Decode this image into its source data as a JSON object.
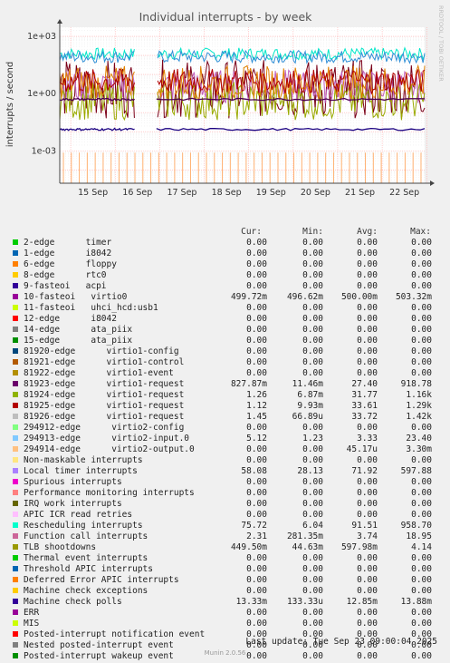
{
  "chart_data": {
    "type": "line",
    "title": "Individual interrupts - by week",
    "ylabel": "interrupts / second",
    "y_scale": "log",
    "ylim": [
      2e-05,
      3000
    ],
    "y_ticks": [
      "1e+03",
      "1e+00",
      "1e-03"
    ],
    "x_ticks": [
      "15 Sep",
      "16 Sep",
      "17 Sep",
      "18 Sep",
      "19 Sep",
      "20 Sep",
      "21 Sep",
      "22 Sep"
    ],
    "watermark": "RRDTOOL / TOBI OETIKER",
    "grid": true,
    "bands": [
      {
        "name": "Rescheduling interrupts",
        "color": "#00e6c8",
        "lo": 60,
        "hi": 250
      },
      {
        "name": "Local timer interrupts",
        "color": "#2f8ed6",
        "lo": 40,
        "hi": 180
      },
      {
        "name": "virtio1-request",
        "color": "#7a0018",
        "lo": 0.05,
        "hi": 60
      },
      {
        "name": "Function call interrupts",
        "color": "#c060c0",
        "lo": 0.3,
        "hi": 18
      },
      {
        "name": "TLB shootdowns",
        "color": "#99aa00",
        "lo": 0.04,
        "hi": 4
      },
      {
        "name": "virtio1-request",
        "color": "#e08000",
        "lo": 0.5,
        "hi": 30
      },
      {
        "name": "virtio1-request",
        "color": "#b00000",
        "lo": 1,
        "hi": 20
      }
    ],
    "flat_series": [
      {
        "name": "Machine check polls",
        "color": "#1a0080",
        "value": 0.0133
      },
      {
        "name": "virtio1-request",
        "color": "#4a0050",
        "value": 0.5
      }
    ],
    "spike_series": {
      "name": "294914-edge virtio2-output.0",
      "color": "#ffb070",
      "value": 3.3,
      "floor": 2e-05
    }
  },
  "legend": {
    "headers": {
      "cur": "Cur:",
      "min": "Min:",
      "avg": "Avg:",
      "max": "Max:"
    },
    "rows": [
      {
        "color": "#00cc00",
        "name": "2-edge      timer",
        "cur": "0.00",
        "min": "0.00",
        "avg": "0.00",
        "max": "0.00"
      },
      {
        "color": "#0066b3",
        "name": "1-edge      i8042",
        "cur": "0.00",
        "min": "0.00",
        "avg": "0.00",
        "max": "0.00"
      },
      {
        "color": "#ff8000",
        "name": "6-edge      floppy",
        "cur": "0.00",
        "min": "0.00",
        "avg": "0.00",
        "max": "0.00"
      },
      {
        "color": "#ffcc00",
        "name": "8-edge      rtc0",
        "cur": "0.00",
        "min": "0.00",
        "avg": "0.00",
        "max": "0.00"
      },
      {
        "color": "#330099",
        "name": "9-fasteoi   acpi",
        "cur": "0.00",
        "min": "0.00",
        "avg": "0.00",
        "max": "0.00"
      },
      {
        "color": "#990099",
        "name": "10-fasteoi   virtio0",
        "cur": "499.72m",
        "min": "496.62m",
        "avg": "500.00m",
        "max": "503.32m"
      },
      {
        "color": "#ccff00",
        "name": "11-fasteoi   uhci_hcd:usb1",
        "cur": "0.00",
        "min": "0.00",
        "avg": "0.00",
        "max": "0.00"
      },
      {
        "color": "#ff0000",
        "name": "12-edge      i8042",
        "cur": "0.00",
        "min": "0.00",
        "avg": "0.00",
        "max": "0.00"
      },
      {
        "color": "#808080",
        "name": "14-edge      ata_piix",
        "cur": "0.00",
        "min": "0.00",
        "avg": "0.00",
        "max": "0.00"
      },
      {
        "color": "#008f00",
        "name": "15-edge      ata_piix",
        "cur": "0.00",
        "min": "0.00",
        "avg": "0.00",
        "max": "0.00"
      },
      {
        "color": "#00487d",
        "name": "81920-edge      virtio1-config",
        "cur": "0.00",
        "min": "0.00",
        "avg": "0.00",
        "max": "0.00"
      },
      {
        "color": "#b35a00",
        "name": "81921-edge      virtio1-control",
        "cur": "0.00",
        "min": "0.00",
        "avg": "0.00",
        "max": "0.00"
      },
      {
        "color": "#b38f00",
        "name": "81922-edge      virtio1-event",
        "cur": "0.00",
        "min": "0.00",
        "avg": "0.00",
        "max": "0.00"
      },
      {
        "color": "#6b006b",
        "name": "81923-edge      virtio1-request",
        "cur": "827.87m",
        "min": "11.46m",
        "avg": "27.40",
        "max": "918.78"
      },
      {
        "color": "#8fb300",
        "name": "81924-edge      virtio1-request",
        "cur": "1.26",
        "min": "6.87m",
        "avg": "31.77",
        "max": "1.16k"
      },
      {
        "color": "#b30000",
        "name": "81925-edge      virtio1-request",
        "cur": "1.12",
        "min": "9.93m",
        "avg": "33.61",
        "max": "1.29k"
      },
      {
        "color": "#bebebe",
        "name": "81926-edge      virtio1-request",
        "cur": "1.45",
        "min": "66.89u",
        "avg": "33.72",
        "max": "1.42k"
      },
      {
        "color": "#80ff80",
        "name": "294912-edge      virtio2-config",
        "cur": "0.00",
        "min": "0.00",
        "avg": "0.00",
        "max": "0.00"
      },
      {
        "color": "#80c9ff",
        "name": "294913-edge      virtio2-input.0",
        "cur": "5.12",
        "min": "1.23",
        "avg": "3.33",
        "max": "23.40"
      },
      {
        "color": "#ffc080",
        "name": "294914-edge      virtio2-output.0",
        "cur": "0.00",
        "min": "0.00",
        "avg": "45.17u",
        "max": "3.30m"
      },
      {
        "color": "#ffe680",
        "name": "Non-maskable interrupts",
        "cur": "0.00",
        "min": "0.00",
        "avg": "0.00",
        "max": "0.00"
      },
      {
        "color": "#aa80ff",
        "name": "Local timer interrupts",
        "cur": "58.08",
        "min": "28.13",
        "avg": "71.92",
        "max": "597.88"
      },
      {
        "color": "#ee00cc",
        "name": "Spurious interrupts",
        "cur": "0.00",
        "min": "0.00",
        "avg": "0.00",
        "max": "0.00"
      },
      {
        "color": "#ff8080",
        "name": "Performance monitoring interrupts",
        "cur": "0.00",
        "min": "0.00",
        "avg": "0.00",
        "max": "0.00"
      },
      {
        "color": "#666600",
        "name": "IRQ work interrupts",
        "cur": "0.00",
        "min": "0.00",
        "avg": "0.00",
        "max": "0.00"
      },
      {
        "color": "#ffbfff",
        "name": "APIC ICR read retries",
        "cur": "0.00",
        "min": "0.00",
        "avg": "0.00",
        "max": "0.00"
      },
      {
        "color": "#00ffcc",
        "name": "Rescheduling interrupts",
        "cur": "75.72",
        "min": "6.04",
        "avg": "91.51",
        "max": "958.70"
      },
      {
        "color": "#cc6699",
        "name": "Function call interrupts",
        "cur": "2.31",
        "min": "281.35m",
        "avg": "3.74",
        "max": "18.95"
      },
      {
        "color": "#999900",
        "name": "TLB shootdowns",
        "cur": "449.50m",
        "min": "44.63m",
        "avg": "597.98m",
        "max": "4.14"
      },
      {
        "color": "#00cc00",
        "name": "Thermal event interrupts",
        "cur": "0.00",
        "min": "0.00",
        "avg": "0.00",
        "max": "0.00"
      },
      {
        "color": "#0066b3",
        "name": "Threshold APIC interrupts",
        "cur": "0.00",
        "min": "0.00",
        "avg": "0.00",
        "max": "0.00"
      },
      {
        "color": "#ff8000",
        "name": "Deferred Error APIC interrupts",
        "cur": "0.00",
        "min": "0.00",
        "avg": "0.00",
        "max": "0.00"
      },
      {
        "color": "#ffcc00",
        "name": "Machine check exceptions",
        "cur": "0.00",
        "min": "0.00",
        "avg": "0.00",
        "max": "0.00"
      },
      {
        "color": "#330099",
        "name": "Machine check polls",
        "cur": "13.33m",
        "min": "133.33u",
        "avg": "12.85m",
        "max": "13.88m"
      },
      {
        "color": "#990099",
        "name": "ERR",
        "cur": "0.00",
        "min": "0.00",
        "avg": "0.00",
        "max": "0.00"
      },
      {
        "color": "#ccff00",
        "name": "MIS",
        "cur": "0.00",
        "min": "0.00",
        "avg": "0.00",
        "max": "0.00"
      },
      {
        "color": "#ff0000",
        "name": "Posted-interrupt notification event",
        "cur": "0.00",
        "min": "0.00",
        "avg": "0.00",
        "max": "0.00"
      },
      {
        "color": "#808080",
        "name": "Nested posted-interrupt event",
        "cur": "0.00",
        "min": "0.00",
        "avg": "0.00",
        "max": "0.00"
      },
      {
        "color": "#008f00",
        "name": "Posted-interrupt wakeup event",
        "cur": "0.00",
        "min": "0.00",
        "avg": "0.00",
        "max": "0.00"
      }
    ]
  },
  "footer": {
    "last_update": "Last update: Tue Sep 23 09:00:04 2025",
    "version": "Munin 2.0.56"
  }
}
